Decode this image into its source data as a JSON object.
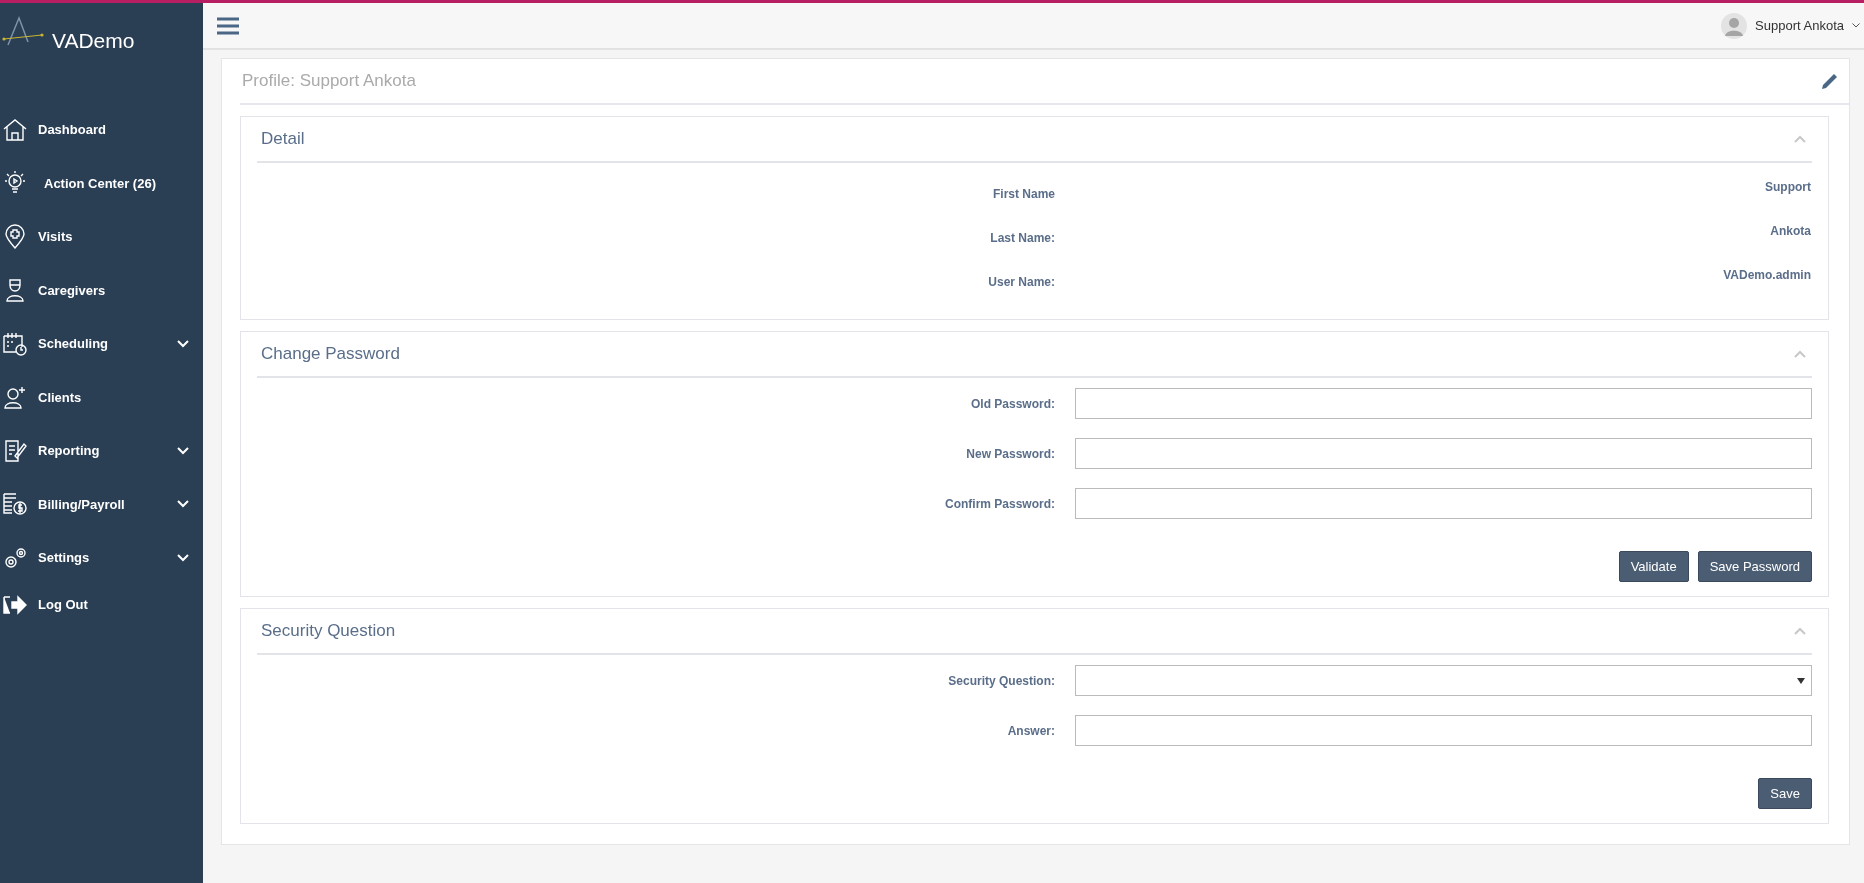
{
  "brand": "VADemo",
  "sidebar": {
    "items": [
      {
        "label": "Dashboard",
        "has_submenu": false
      },
      {
        "label": "Action Center (26)",
        "has_submenu": false
      },
      {
        "label": "Visits",
        "has_submenu": false
      },
      {
        "label": "Caregivers",
        "has_submenu": false
      },
      {
        "label": "Scheduling",
        "has_submenu": true
      },
      {
        "label": "Clients",
        "has_submenu": false
      },
      {
        "label": "Reporting",
        "has_submenu": true
      },
      {
        "label": "Billing/Payroll",
        "has_submenu": true
      },
      {
        "label": "Settings",
        "has_submenu": true
      },
      {
        "label": "Log Out",
        "has_submenu": false
      }
    ]
  },
  "user": {
    "name": "Support Ankota"
  },
  "page_title": "Profile: Support Ankota",
  "sections": [
    {
      "kind": "detail",
      "title": "Detail",
      "expanded": true,
      "fields": [
        {
          "label": "First Name",
          "value": "Support"
        },
        {
          "label": "Last Name:",
          "value": "Ankota"
        },
        {
          "label": "User Name:",
          "value": "VADemo.admin"
        }
      ]
    },
    {
      "kind": "form",
      "title": "Change Password",
      "expanded": true,
      "fields": [
        {
          "label": "Old Password:",
          "kind": "text"
        },
        {
          "label": "New Password:",
          "kind": "text"
        },
        {
          "label": "Confirm Password:",
          "kind": "text"
        }
      ],
      "buttons": [
        "Validate",
        "Save Password"
      ]
    },
    {
      "kind": "form",
      "title": "Security Question",
      "expanded": true,
      "fields": [
        {
          "label": "Security Question:",
          "kind": "select"
        },
        {
          "label": "Answer:",
          "kind": "text"
        }
      ],
      "buttons": [
        "Save"
      ]
    }
  ]
}
